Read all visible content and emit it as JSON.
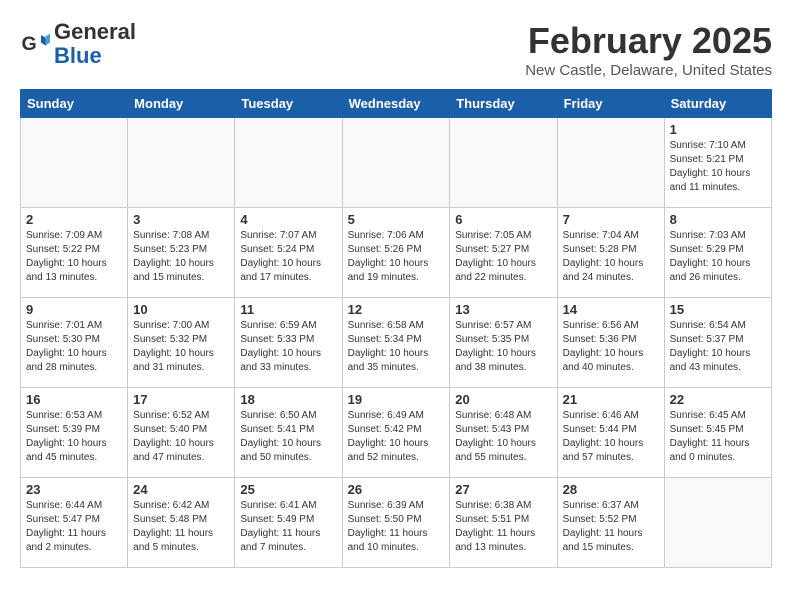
{
  "header": {
    "logo_line1": "General",
    "logo_line2": "Blue",
    "month_title": "February 2025",
    "location": "New Castle, Delaware, United States"
  },
  "weekdays": [
    "Sunday",
    "Monday",
    "Tuesday",
    "Wednesday",
    "Thursday",
    "Friday",
    "Saturday"
  ],
  "weeks": [
    [
      {
        "day": "",
        "info": ""
      },
      {
        "day": "",
        "info": ""
      },
      {
        "day": "",
        "info": ""
      },
      {
        "day": "",
        "info": ""
      },
      {
        "day": "",
        "info": ""
      },
      {
        "day": "",
        "info": ""
      },
      {
        "day": "1",
        "info": "Sunrise: 7:10 AM\nSunset: 5:21 PM\nDaylight: 10 hours\nand 11 minutes."
      }
    ],
    [
      {
        "day": "2",
        "info": "Sunrise: 7:09 AM\nSunset: 5:22 PM\nDaylight: 10 hours\nand 13 minutes."
      },
      {
        "day": "3",
        "info": "Sunrise: 7:08 AM\nSunset: 5:23 PM\nDaylight: 10 hours\nand 15 minutes."
      },
      {
        "day": "4",
        "info": "Sunrise: 7:07 AM\nSunset: 5:24 PM\nDaylight: 10 hours\nand 17 minutes."
      },
      {
        "day": "5",
        "info": "Sunrise: 7:06 AM\nSunset: 5:26 PM\nDaylight: 10 hours\nand 19 minutes."
      },
      {
        "day": "6",
        "info": "Sunrise: 7:05 AM\nSunset: 5:27 PM\nDaylight: 10 hours\nand 22 minutes."
      },
      {
        "day": "7",
        "info": "Sunrise: 7:04 AM\nSunset: 5:28 PM\nDaylight: 10 hours\nand 24 minutes."
      },
      {
        "day": "8",
        "info": "Sunrise: 7:03 AM\nSunset: 5:29 PM\nDaylight: 10 hours\nand 26 minutes."
      }
    ],
    [
      {
        "day": "9",
        "info": "Sunrise: 7:01 AM\nSunset: 5:30 PM\nDaylight: 10 hours\nand 28 minutes."
      },
      {
        "day": "10",
        "info": "Sunrise: 7:00 AM\nSunset: 5:32 PM\nDaylight: 10 hours\nand 31 minutes."
      },
      {
        "day": "11",
        "info": "Sunrise: 6:59 AM\nSunset: 5:33 PM\nDaylight: 10 hours\nand 33 minutes."
      },
      {
        "day": "12",
        "info": "Sunrise: 6:58 AM\nSunset: 5:34 PM\nDaylight: 10 hours\nand 35 minutes."
      },
      {
        "day": "13",
        "info": "Sunrise: 6:57 AM\nSunset: 5:35 PM\nDaylight: 10 hours\nand 38 minutes."
      },
      {
        "day": "14",
        "info": "Sunrise: 6:56 AM\nSunset: 5:36 PM\nDaylight: 10 hours\nand 40 minutes."
      },
      {
        "day": "15",
        "info": "Sunrise: 6:54 AM\nSunset: 5:37 PM\nDaylight: 10 hours\nand 43 minutes."
      }
    ],
    [
      {
        "day": "16",
        "info": "Sunrise: 6:53 AM\nSunset: 5:39 PM\nDaylight: 10 hours\nand 45 minutes."
      },
      {
        "day": "17",
        "info": "Sunrise: 6:52 AM\nSunset: 5:40 PM\nDaylight: 10 hours\nand 47 minutes."
      },
      {
        "day": "18",
        "info": "Sunrise: 6:50 AM\nSunset: 5:41 PM\nDaylight: 10 hours\nand 50 minutes."
      },
      {
        "day": "19",
        "info": "Sunrise: 6:49 AM\nSunset: 5:42 PM\nDaylight: 10 hours\nand 52 minutes."
      },
      {
        "day": "20",
        "info": "Sunrise: 6:48 AM\nSunset: 5:43 PM\nDaylight: 10 hours\nand 55 minutes."
      },
      {
        "day": "21",
        "info": "Sunrise: 6:46 AM\nSunset: 5:44 PM\nDaylight: 10 hours\nand 57 minutes."
      },
      {
        "day": "22",
        "info": "Sunrise: 6:45 AM\nSunset: 5:45 PM\nDaylight: 11 hours\nand 0 minutes."
      }
    ],
    [
      {
        "day": "23",
        "info": "Sunrise: 6:44 AM\nSunset: 5:47 PM\nDaylight: 11 hours\nand 2 minutes."
      },
      {
        "day": "24",
        "info": "Sunrise: 6:42 AM\nSunset: 5:48 PM\nDaylight: 11 hours\nand 5 minutes."
      },
      {
        "day": "25",
        "info": "Sunrise: 6:41 AM\nSunset: 5:49 PM\nDaylight: 11 hours\nand 7 minutes."
      },
      {
        "day": "26",
        "info": "Sunrise: 6:39 AM\nSunset: 5:50 PM\nDaylight: 11 hours\nand 10 minutes."
      },
      {
        "day": "27",
        "info": "Sunrise: 6:38 AM\nSunset: 5:51 PM\nDaylight: 11 hours\nand 13 minutes."
      },
      {
        "day": "28",
        "info": "Sunrise: 6:37 AM\nSunset: 5:52 PM\nDaylight: 11 hours\nand 15 minutes."
      },
      {
        "day": "",
        "info": ""
      }
    ]
  ]
}
